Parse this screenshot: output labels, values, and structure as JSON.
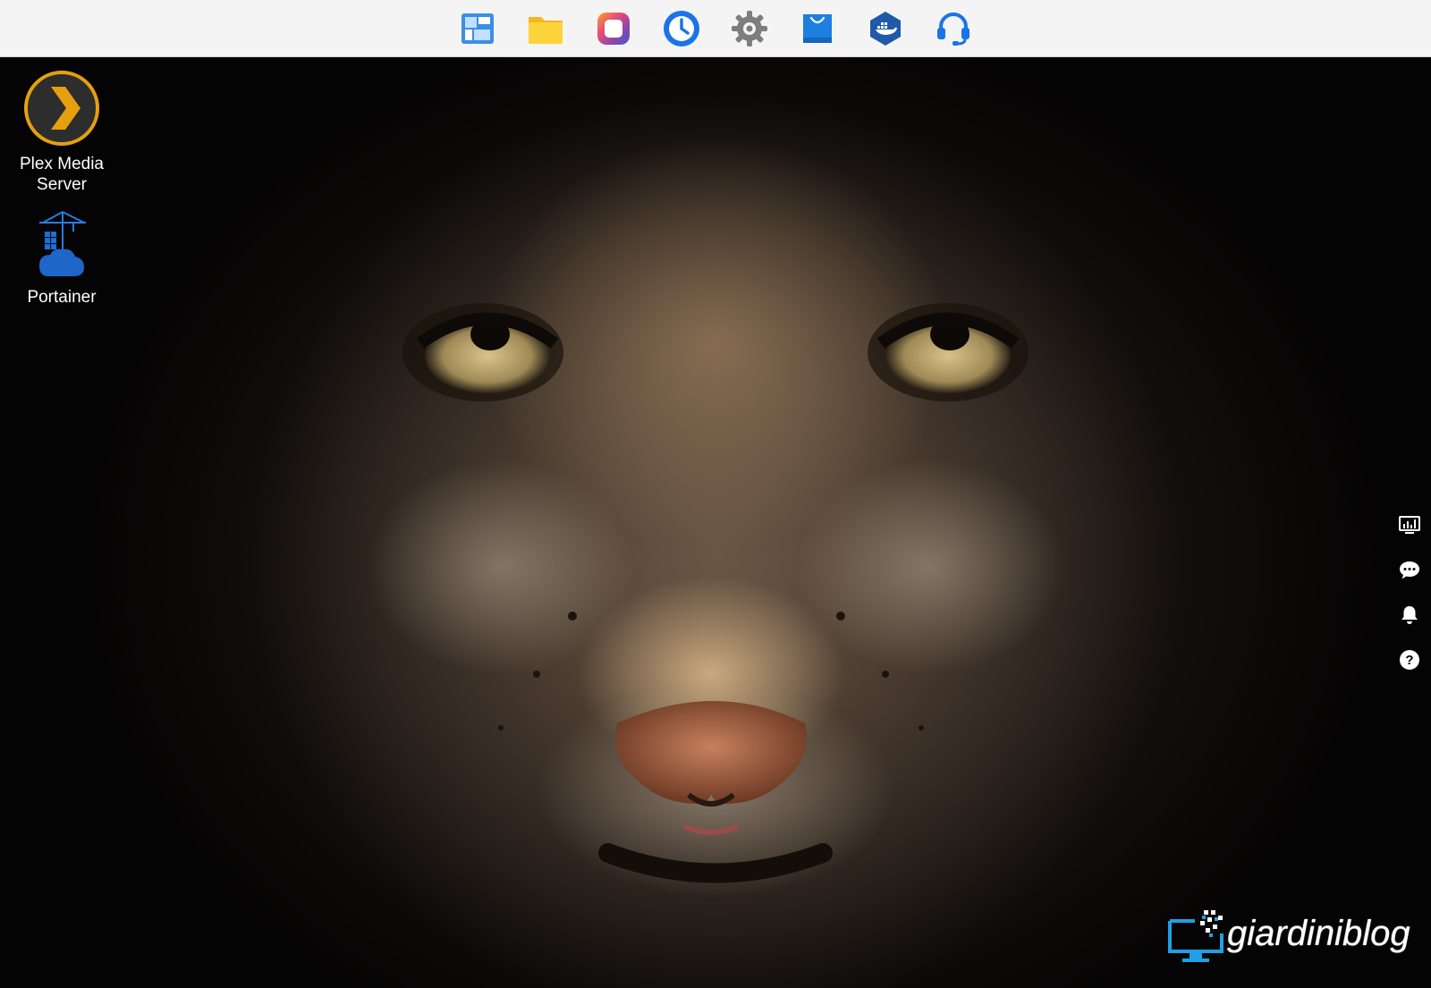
{
  "taskbar": {
    "items": [
      {
        "name": "main-menu",
        "icon": "grid-panels-icon",
        "color": "#3a8ee6"
      },
      {
        "name": "file-station",
        "icon": "folder-icon",
        "color": "#f2c230"
      },
      {
        "name": "photos",
        "icon": "photos-icon",
        "color": "#e84a7f"
      },
      {
        "name": "backup",
        "icon": "clock-backup-icon",
        "color": "#1a73e8"
      },
      {
        "name": "control-panel",
        "icon": "gear-icon",
        "color": "#7a7a7a"
      },
      {
        "name": "package-center",
        "icon": "shopping-bag-icon",
        "color": "#1e7fe0"
      },
      {
        "name": "container-manager",
        "icon": "docker-hexagon-icon",
        "color": "#1e5aa8"
      },
      {
        "name": "support-center",
        "icon": "headset-icon",
        "color": "#1a73e8"
      }
    ]
  },
  "desktop": {
    "shortcuts": [
      {
        "label": "Plex Media Server",
        "label_line1": "Plex Media",
        "label_line2": "Server",
        "icon": "plex-chevron-icon",
        "accent": "#e5a00d"
      },
      {
        "label": "Portainer",
        "icon": "portainer-crane-icon",
        "accent": "#1a6fd8"
      }
    ]
  },
  "side_strip": {
    "items": [
      {
        "name": "resource-monitor",
        "icon": "monitor-chart-icon"
      },
      {
        "name": "messages",
        "icon": "chat-bubble-icon"
      },
      {
        "name": "notifications",
        "icon": "bell-icon"
      },
      {
        "name": "help",
        "icon": "question-icon",
        "label": "?"
      }
    ]
  },
  "watermark": {
    "text": "giardiniblog",
    "icon": "monitor-pixels-icon",
    "color": "#1ea0e6"
  }
}
